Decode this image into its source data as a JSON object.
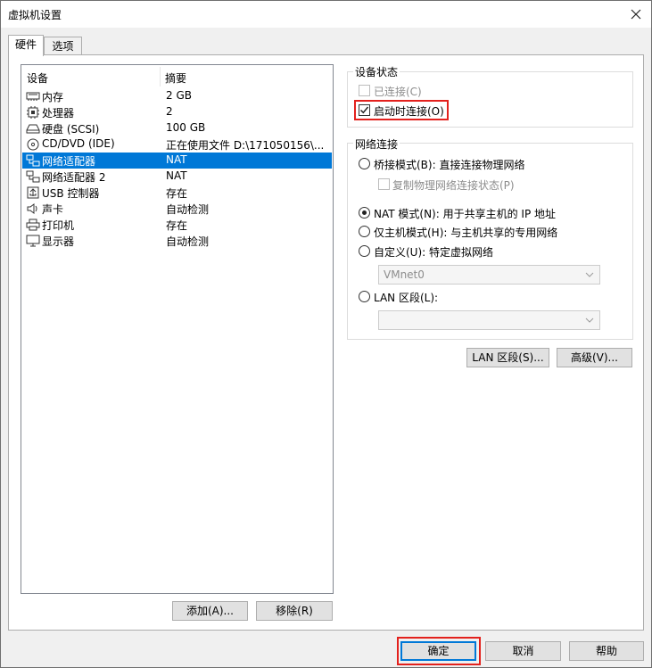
{
  "window": {
    "title": "虚拟机设置"
  },
  "tabs": [
    {
      "label": "硬件",
      "active": true
    },
    {
      "label": "选项",
      "active": false
    }
  ],
  "device_list": {
    "columns": [
      "设备",
      "摘要"
    ],
    "rows": [
      {
        "icon": "memory-icon",
        "name": "内存",
        "summary": "2 GB",
        "selected": false
      },
      {
        "icon": "processor-icon",
        "name": "处理器",
        "summary": "2",
        "selected": false
      },
      {
        "icon": "hard-disk-icon",
        "name": "硬盘 (SCSI)",
        "summary": "100 GB",
        "selected": false
      },
      {
        "icon": "cd-dvd-icon",
        "name": "CD/DVD (IDE)",
        "summary": "正在使用文件 D:\\171050156\\...",
        "selected": false
      },
      {
        "icon": "network-adapter-icon",
        "name": "网络适配器",
        "summary": "NAT",
        "selected": true
      },
      {
        "icon": "network-adapter-icon",
        "name": "网络适配器 2",
        "summary": "NAT",
        "selected": false
      },
      {
        "icon": "usb-icon",
        "name": "USB 控制器",
        "summary": "存在",
        "selected": false
      },
      {
        "icon": "sound-card-icon",
        "name": "声卡",
        "summary": "自动检测",
        "selected": false
      },
      {
        "icon": "printer-icon",
        "name": "打印机",
        "summary": "存在",
        "selected": false
      },
      {
        "icon": "display-icon",
        "name": "显示器",
        "summary": "自动检测",
        "selected": false
      }
    ],
    "add_label": "添加(A)...",
    "remove_label": "移除(R)"
  },
  "device_status": {
    "title": "设备状态",
    "connected_label": "已连接(C)",
    "connected_checked": false,
    "connect_at_power_on_label": "启动时连接(O)",
    "connect_at_power_on_checked": true
  },
  "network_connection": {
    "title": "网络连接",
    "bridged_label": "桥接模式(B): 直接连接物理网络",
    "replicate_label": "复制物理网络连接状态(P)",
    "nat_label": "NAT 模式(N): 用于共享主机的 IP 地址",
    "host_only_label": "仅主机模式(H): 与主机共享的专用网络",
    "custom_label": "自定义(U): 特定虚拟网络",
    "custom_select_value": "VMnet0",
    "lan_segment_label": "LAN 区段(L):",
    "lan_segment_select_value": "",
    "selected": "nat"
  },
  "panel_buttons": {
    "lan_segments_label": "LAN 区段(S)...",
    "advanced_label": "高级(V)..."
  },
  "footer": {
    "ok_label": "确定",
    "cancel_label": "取消",
    "help_label": "帮助"
  },
  "colors": {
    "selection": "#0078d7",
    "highlight": "#e3211d"
  }
}
